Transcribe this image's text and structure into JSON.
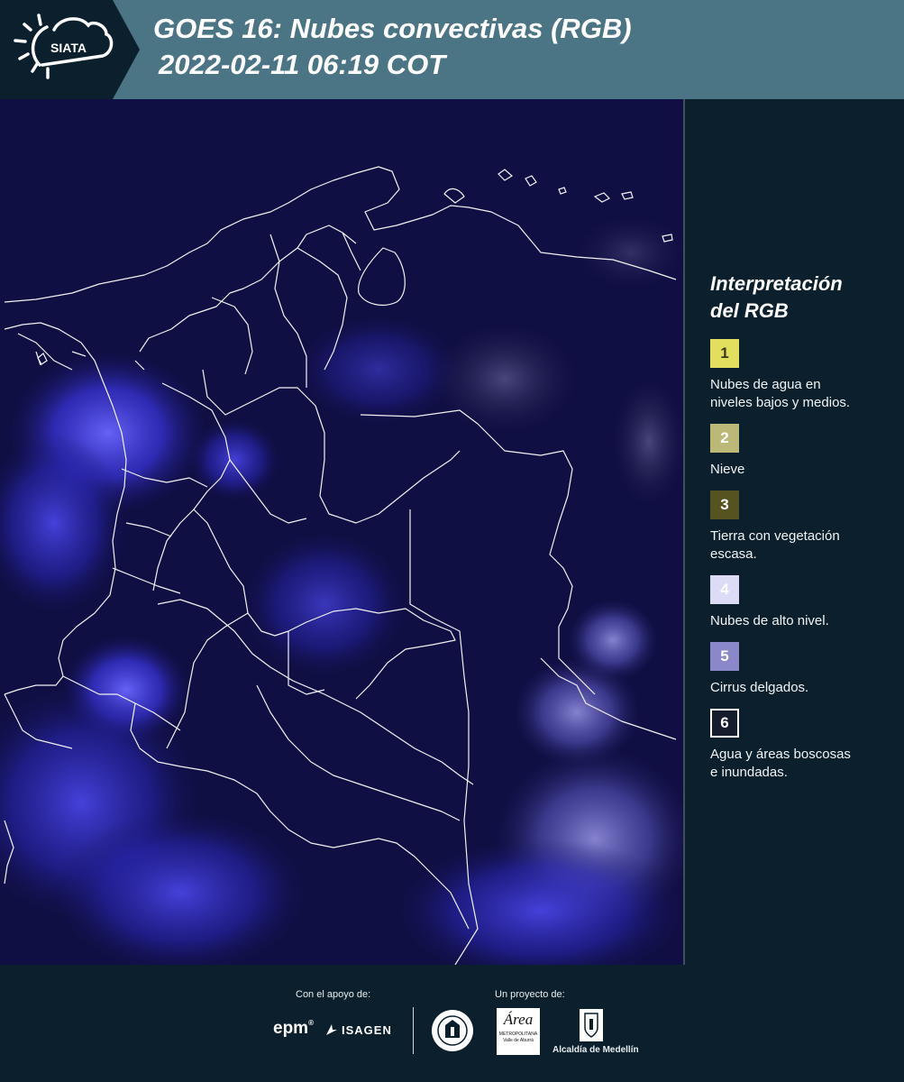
{
  "header": {
    "brand": "SIATA",
    "title_line1": "GOES 16: Nubes convectivas (RGB)",
    "title_line2": "2022-02-11 06:19 COT"
  },
  "legend": {
    "title_line1": "Interpretación",
    "title_line2": "del RGB",
    "items": [
      {
        "number": "1",
        "label_line1": "Nubes de agua en",
        "label_line2": "niveles bajos y medios.",
        "color": "#e2df5f",
        "text_color": "#3a3a1a"
      },
      {
        "number": "2",
        "label_line1": "Nieve",
        "label_line2": "",
        "color": "#bcb978",
        "text_color": "#ffffff"
      },
      {
        "number": "3",
        "label_line1": "Tierra con vegetación",
        "label_line2": "escasa.",
        "color": "#555320",
        "text_color": "#ffffff"
      },
      {
        "number": "4",
        "label_line1": "Nubes de alto nivel.",
        "label_line2": "",
        "color": "#dcdcf7",
        "text_color": "#ffffff"
      },
      {
        "number": "5",
        "label_line1": "Cirrus delgados.",
        "label_line2": "",
        "color": "#8a88c9",
        "text_color": "#ffffff"
      },
      {
        "number": "6",
        "label_line1": "Agua y áreas boscosas",
        "label_line2": "e inundadas.",
        "color": "#151c2b",
        "text_color": "#ffffff"
      }
    ]
  },
  "footer": {
    "support_label": "Con el apoyo de:",
    "project_label": "Un proyecto de:",
    "sponsor1": "epm",
    "sponsor2": "ISAGEN",
    "partner_area": "Área",
    "partner_area_sub1": "METROPOLITANA",
    "partner_area_sub2": "Valle de Aburrá",
    "partner_alcaldia": "Alcaldía de Medellín"
  }
}
